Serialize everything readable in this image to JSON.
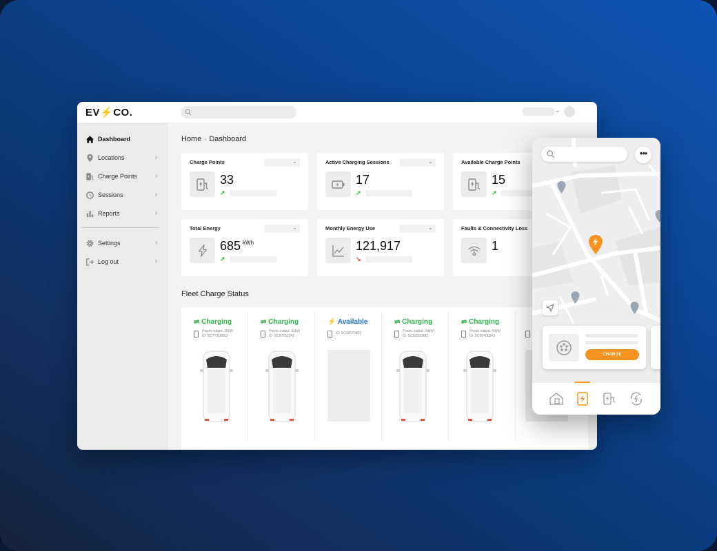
{
  "brand": {
    "logo_prefix": "EV",
    "logo_suffix": "CO."
  },
  "sidebar": {
    "items": [
      {
        "label": "Dashboard",
        "icon": "home-icon"
      },
      {
        "label": "Locations",
        "icon": "location-pin-icon"
      },
      {
        "label": "Charge Points",
        "icon": "charge-point-icon"
      },
      {
        "label": "Sessions",
        "icon": "sessions-icon"
      },
      {
        "label": "Reports",
        "icon": "bar-chart-icon"
      },
      {
        "label": "Settings",
        "icon": "gear-icon"
      },
      {
        "label": "Log out",
        "icon": "logout-icon"
      }
    ]
  },
  "breadcrumb": {
    "home": "Home",
    "current": "Dashboard"
  },
  "cards": [
    {
      "title": "Charge Points",
      "value": "33",
      "unit": "",
      "trend": "up",
      "icon": "charge-point-icon"
    },
    {
      "title": "Active Charging Sessions",
      "value": "17",
      "unit": "",
      "trend": "up",
      "icon": "battery-charging-icon"
    },
    {
      "title": "Available Charge Points",
      "value": "15",
      "unit": "",
      "trend": "up",
      "icon": "charge-point-icon"
    },
    {
      "title": "Total Energy",
      "value": "685",
      "unit": "kWh",
      "trend": "up",
      "icon": "lightning-icon"
    },
    {
      "title": "Monthly Energy Use",
      "value": "121,917",
      "unit": "",
      "trend": "down",
      "icon": "line-chart-icon"
    },
    {
      "title": "Faults & Connectivity Loss",
      "value": "1",
      "unit": "",
      "trend": "",
      "icon": "wifi-off-icon"
    }
  ],
  "fleet": {
    "title": "Fleet Charge Status",
    "bays": [
      {
        "status": "Charging",
        "kind": "charging",
        "power": "Power output: 35kW",
        "id": "ID: SC77310053"
      },
      {
        "status": "Charging",
        "kind": "charging",
        "power": "Power output: 41kW",
        "id": "ID: SC87552341"
      },
      {
        "status": "Available",
        "kind": "available",
        "power": "",
        "id": "ID: SC02670481"
      },
      {
        "status": "Charging",
        "kind": "charging",
        "power": "Power output: 43kW",
        "id": "ID: SC92550991"
      },
      {
        "status": "Charging",
        "kind": "charging",
        "power": "Power output: 43kW",
        "id": "ID: SC56490343"
      }
    ]
  },
  "phone": {
    "charge_button": "CHARGE",
    "tabs": [
      "home-charger-icon",
      "charge-station-icon",
      "card-charger-icon",
      "power-cycle-icon"
    ],
    "active_tab": 1
  },
  "colors": {
    "accent": "#f7931e",
    "charging": "#2cb34a",
    "available": "#1e6fd0",
    "trend_down": "#e53935"
  }
}
